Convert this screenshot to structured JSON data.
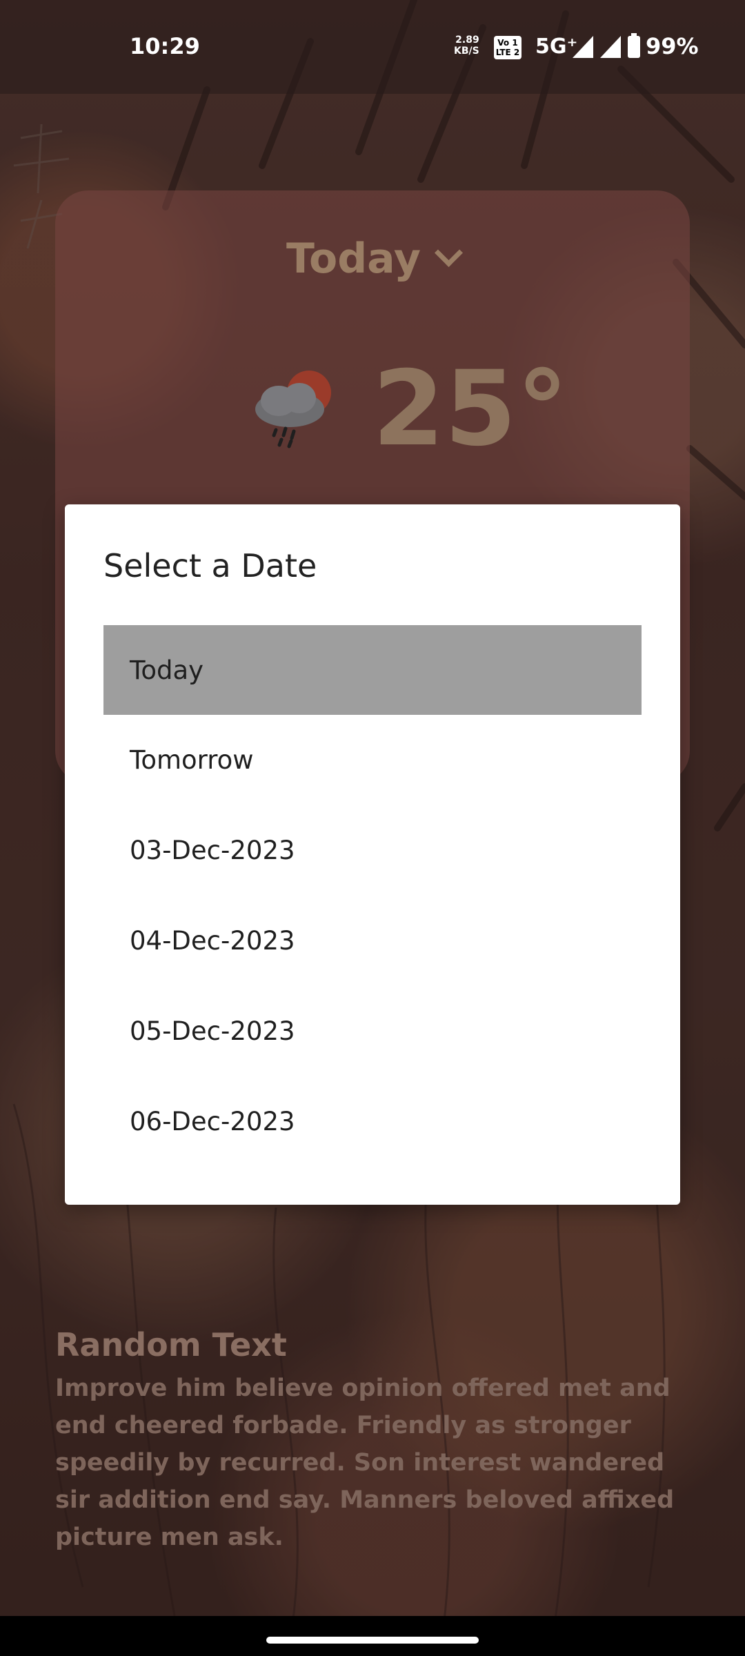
{
  "status_bar": {
    "time": "10:29",
    "speed_value": "2.89",
    "speed_unit": "KB/S",
    "volte_top": "Vo 1",
    "volte_bottom": "LTE 2",
    "network": "5G⁺",
    "battery": "99%"
  },
  "weather": {
    "day_label": "Today",
    "temperature": "25°",
    "icon": "rain-cloud-sun-icon"
  },
  "dialog": {
    "title": "Select a Date",
    "options": [
      {
        "label": "Today",
        "selected": true
      },
      {
        "label": "Tomorrow",
        "selected": false
      },
      {
        "label": "03-Dec-2023",
        "selected": false
      },
      {
        "label": "04-Dec-2023",
        "selected": false
      },
      {
        "label": "05-Dec-2023",
        "selected": false
      },
      {
        "label": "06-Dec-2023",
        "selected": false
      }
    ]
  },
  "random": {
    "title": "Random Text",
    "body": "Improve him believe opinion offered met and end cheered forbade. Friendly as stronger speedily by recurred. Son interest wandered sir addition end say. Manners beloved affixed picture men ask."
  },
  "colors": {
    "dialog_bg": "#ffffff",
    "selected_option_bg": "#9e9e9e",
    "muted_text": "#9a7d64"
  }
}
